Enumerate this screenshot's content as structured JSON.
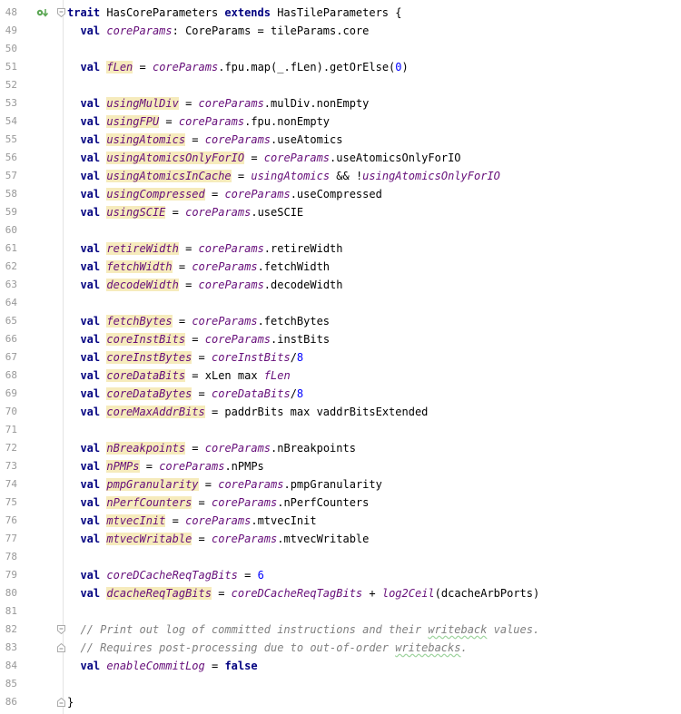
{
  "editor": {
    "lines": [
      {
        "number": "48",
        "gutter_icon": "implements-arrow-icon",
        "fold": "fold-open-icon",
        "tokens": [
          [
            "kw",
            "trait"
          ],
          [
            "tp",
            " HasCoreParameters "
          ],
          [
            "kw",
            "extends"
          ],
          [
            "tp",
            " HasTileParameters {"
          ]
        ]
      },
      {
        "number": "49",
        "tokens": [
          [
            "tp",
            "  "
          ],
          [
            "kw",
            "val"
          ],
          [
            "tp",
            " "
          ],
          [
            "mf",
            "coreParams"
          ],
          [
            "tp",
            ": CoreParams = tileParams.core"
          ]
        ]
      },
      {
        "number": "50",
        "tokens": []
      },
      {
        "number": "51",
        "tokens": [
          [
            "tp",
            "  "
          ],
          [
            "kw",
            "val"
          ],
          [
            "tp",
            " "
          ],
          [
            "mfd",
            "fLen"
          ],
          [
            "tp",
            " = "
          ],
          [
            "mf",
            "coreParams"
          ],
          [
            "tp",
            ".fpu.map(_.fLen).getOrElse("
          ],
          [
            "num",
            "0"
          ],
          [
            "tp",
            ")"
          ]
        ]
      },
      {
        "number": "52",
        "tokens": []
      },
      {
        "number": "53",
        "tokens": [
          [
            "tp",
            "  "
          ],
          [
            "kw",
            "val"
          ],
          [
            "tp",
            " "
          ],
          [
            "mfd",
            "usingMulDiv"
          ],
          [
            "tp",
            " = "
          ],
          [
            "mf",
            "coreParams"
          ],
          [
            "tp",
            ".mulDiv.nonEmpty"
          ]
        ]
      },
      {
        "number": "54",
        "tokens": [
          [
            "tp",
            "  "
          ],
          [
            "kw",
            "val"
          ],
          [
            "tp",
            " "
          ],
          [
            "mfd",
            "usingFPU"
          ],
          [
            "tp",
            " = "
          ],
          [
            "mf",
            "coreParams"
          ],
          [
            "tp",
            ".fpu.nonEmpty"
          ]
        ]
      },
      {
        "number": "55",
        "tokens": [
          [
            "tp",
            "  "
          ],
          [
            "kw",
            "val"
          ],
          [
            "tp",
            " "
          ],
          [
            "mfd",
            "usingAtomics"
          ],
          [
            "tp",
            " = "
          ],
          [
            "mf",
            "coreParams"
          ],
          [
            "tp",
            ".useAtomics"
          ]
        ]
      },
      {
        "number": "56",
        "tokens": [
          [
            "tp",
            "  "
          ],
          [
            "kw",
            "val"
          ],
          [
            "tp",
            " "
          ],
          [
            "mfd",
            "usingAtomicsOnlyForIO"
          ],
          [
            "tp",
            " = "
          ],
          [
            "mf",
            "coreParams"
          ],
          [
            "tp",
            ".useAtomicsOnlyForIO"
          ]
        ]
      },
      {
        "number": "57",
        "tokens": [
          [
            "tp",
            "  "
          ],
          [
            "kw",
            "val"
          ],
          [
            "tp",
            " "
          ],
          [
            "mfd",
            "usingAtomicsInCache"
          ],
          [
            "tp",
            " = "
          ],
          [
            "mf",
            "usingAtomics"
          ],
          [
            "tp",
            " && !"
          ],
          [
            "mf",
            "usingAtomicsOnlyForIO"
          ]
        ]
      },
      {
        "number": "58",
        "tokens": [
          [
            "tp",
            "  "
          ],
          [
            "kw",
            "val"
          ],
          [
            "tp",
            " "
          ],
          [
            "mfd",
            "usingCompressed"
          ],
          [
            "tp",
            " = "
          ],
          [
            "mf",
            "coreParams"
          ],
          [
            "tp",
            ".useCompressed"
          ]
        ]
      },
      {
        "number": "59",
        "tokens": [
          [
            "tp",
            "  "
          ],
          [
            "kw",
            "val"
          ],
          [
            "tp",
            " "
          ],
          [
            "mfd",
            "usingSCIE"
          ],
          [
            "tp",
            " = "
          ],
          [
            "mf",
            "coreParams"
          ],
          [
            "tp",
            ".useSCIE"
          ]
        ]
      },
      {
        "number": "60",
        "tokens": []
      },
      {
        "number": "61",
        "tokens": [
          [
            "tp",
            "  "
          ],
          [
            "kw",
            "val"
          ],
          [
            "tp",
            " "
          ],
          [
            "mfd",
            "retireWidth"
          ],
          [
            "tp",
            " = "
          ],
          [
            "mf",
            "coreParams"
          ],
          [
            "tp",
            ".retireWidth"
          ]
        ]
      },
      {
        "number": "62",
        "tokens": [
          [
            "tp",
            "  "
          ],
          [
            "kw",
            "val"
          ],
          [
            "tp",
            " "
          ],
          [
            "mfd",
            "fetchWidth"
          ],
          [
            "tp",
            " = "
          ],
          [
            "mf",
            "coreParams"
          ],
          [
            "tp",
            ".fetchWidth"
          ]
        ]
      },
      {
        "number": "63",
        "tokens": [
          [
            "tp",
            "  "
          ],
          [
            "kw",
            "val"
          ],
          [
            "tp",
            " "
          ],
          [
            "mfd",
            "decodeWidth"
          ],
          [
            "tp",
            " = "
          ],
          [
            "mf",
            "coreParams"
          ],
          [
            "tp",
            ".decodeWidth"
          ]
        ]
      },
      {
        "number": "64",
        "tokens": []
      },
      {
        "number": "65",
        "tokens": [
          [
            "tp",
            "  "
          ],
          [
            "kw",
            "val"
          ],
          [
            "tp",
            " "
          ],
          [
            "mfd",
            "fetchBytes"
          ],
          [
            "tp",
            " = "
          ],
          [
            "mf",
            "coreParams"
          ],
          [
            "tp",
            ".fetchBytes"
          ]
        ]
      },
      {
        "number": "66",
        "tokens": [
          [
            "tp",
            "  "
          ],
          [
            "kw",
            "val"
          ],
          [
            "tp",
            " "
          ],
          [
            "mfd",
            "coreInstBits"
          ],
          [
            "tp",
            " = "
          ],
          [
            "mf",
            "coreParams"
          ],
          [
            "tp",
            ".instBits"
          ]
        ]
      },
      {
        "number": "67",
        "tokens": [
          [
            "tp",
            "  "
          ],
          [
            "kw",
            "val"
          ],
          [
            "tp",
            " "
          ],
          [
            "mfd",
            "coreInstBytes"
          ],
          [
            "tp",
            " = "
          ],
          [
            "mf",
            "coreInstBits"
          ],
          [
            "tp",
            "/"
          ],
          [
            "num",
            "8"
          ]
        ]
      },
      {
        "number": "68",
        "tokens": [
          [
            "tp",
            "  "
          ],
          [
            "kw",
            "val"
          ],
          [
            "tp",
            " "
          ],
          [
            "mfd",
            "coreDataBits"
          ],
          [
            "tp",
            " = xLen max "
          ],
          [
            "mf",
            "fLen"
          ]
        ]
      },
      {
        "number": "69",
        "tokens": [
          [
            "tp",
            "  "
          ],
          [
            "kw",
            "val"
          ],
          [
            "tp",
            " "
          ],
          [
            "mfd",
            "coreDataBytes"
          ],
          [
            "tp",
            " = "
          ],
          [
            "mf",
            "coreDataBits"
          ],
          [
            "tp",
            "/"
          ],
          [
            "num",
            "8"
          ]
        ]
      },
      {
        "number": "70",
        "tokens": [
          [
            "tp",
            "  "
          ],
          [
            "kw",
            "val"
          ],
          [
            "tp",
            " "
          ],
          [
            "mfd",
            "coreMaxAddrBits"
          ],
          [
            "tp",
            " = paddrBits max vaddrBitsExtended"
          ]
        ]
      },
      {
        "number": "71",
        "tokens": []
      },
      {
        "number": "72",
        "tokens": [
          [
            "tp",
            "  "
          ],
          [
            "kw",
            "val"
          ],
          [
            "tp",
            " "
          ],
          [
            "mfd",
            "nBreakpoints"
          ],
          [
            "tp",
            " = "
          ],
          [
            "mf",
            "coreParams"
          ],
          [
            "tp",
            ".nBreakpoints"
          ]
        ]
      },
      {
        "number": "73",
        "tokens": [
          [
            "tp",
            "  "
          ],
          [
            "kw",
            "val"
          ],
          [
            "tp",
            " "
          ],
          [
            "mfd",
            "nPMPs"
          ],
          [
            "tp",
            " = "
          ],
          [
            "mf",
            "coreParams"
          ],
          [
            "tp",
            ".nPMPs"
          ]
        ]
      },
      {
        "number": "74",
        "tokens": [
          [
            "tp",
            "  "
          ],
          [
            "kw",
            "val"
          ],
          [
            "tp",
            " "
          ],
          [
            "mfd",
            "pmpGranularity"
          ],
          [
            "tp",
            " = "
          ],
          [
            "mf",
            "coreParams"
          ],
          [
            "tp",
            ".pmpGranularity"
          ]
        ]
      },
      {
        "number": "75",
        "tokens": [
          [
            "tp",
            "  "
          ],
          [
            "kw",
            "val"
          ],
          [
            "tp",
            " "
          ],
          [
            "mfd",
            "nPerfCounters"
          ],
          [
            "tp",
            " = "
          ],
          [
            "mf",
            "coreParams"
          ],
          [
            "tp",
            ".nPerfCounters"
          ]
        ]
      },
      {
        "number": "76",
        "tokens": [
          [
            "tp",
            "  "
          ],
          [
            "kw",
            "val"
          ],
          [
            "tp",
            " "
          ],
          [
            "mfd",
            "mtvecInit"
          ],
          [
            "tp",
            " = "
          ],
          [
            "mf",
            "coreParams"
          ],
          [
            "tp",
            ".mtvecInit"
          ]
        ]
      },
      {
        "number": "77",
        "tokens": [
          [
            "tp",
            "  "
          ],
          [
            "kw",
            "val"
          ],
          [
            "tp",
            " "
          ],
          [
            "mfd",
            "mtvecWritable"
          ],
          [
            "tp",
            " = "
          ],
          [
            "mf",
            "coreParams"
          ],
          [
            "tp",
            ".mtvecWritable"
          ]
        ]
      },
      {
        "number": "78",
        "tokens": []
      },
      {
        "number": "79",
        "tokens": [
          [
            "tp",
            "  "
          ],
          [
            "kw",
            "val"
          ],
          [
            "tp",
            " "
          ],
          [
            "mf",
            "coreDCacheReqTagBits"
          ],
          [
            "tp",
            " = "
          ],
          [
            "num",
            "6"
          ]
        ]
      },
      {
        "number": "80",
        "tokens": [
          [
            "tp",
            "  "
          ],
          [
            "kw",
            "val"
          ],
          [
            "tp",
            " "
          ],
          [
            "mfd",
            "dcacheReqTagBits"
          ],
          [
            "tp",
            " = "
          ],
          [
            "mf",
            "coreDCacheReqTagBits"
          ],
          [
            "tp",
            " + "
          ],
          [
            "mf",
            "log2Ceil"
          ],
          [
            "tp",
            "(dcacheArbPorts)"
          ]
        ]
      },
      {
        "number": "81",
        "tokens": []
      },
      {
        "number": "82",
        "fold": "fold-open-icon",
        "tokens": [
          [
            "tp",
            "  "
          ],
          [
            "cm",
            "// Print out log of committed instructions and their "
          ],
          [
            "cmw",
            "writeback"
          ],
          [
            "cm",
            " values."
          ]
        ]
      },
      {
        "number": "83",
        "fold": "fold-close-icon",
        "tokens": [
          [
            "tp",
            "  "
          ],
          [
            "cm",
            "// Requires post-processing due to out-of-order "
          ],
          [
            "cmw",
            "writebacks"
          ],
          [
            "cm",
            "."
          ]
        ]
      },
      {
        "number": "84",
        "tokens": [
          [
            "tp",
            "  "
          ],
          [
            "kw",
            "val"
          ],
          [
            "tp",
            " "
          ],
          [
            "mf",
            "enableCommitLog"
          ],
          [
            "tp",
            " = "
          ],
          [
            "kw",
            "false"
          ]
        ]
      },
      {
        "number": "85",
        "tokens": []
      },
      {
        "number": "86",
        "fold": "fold-close-icon",
        "tokens": [
          [
            "tp",
            "}"
          ]
        ]
      }
    ]
  },
  "colors": {
    "keyword": "#000080",
    "member": "#660e7a",
    "number": "#0000ff",
    "comment": "#808080",
    "declaration_highlight": "#f6ebbc",
    "line_number": "#999999"
  }
}
